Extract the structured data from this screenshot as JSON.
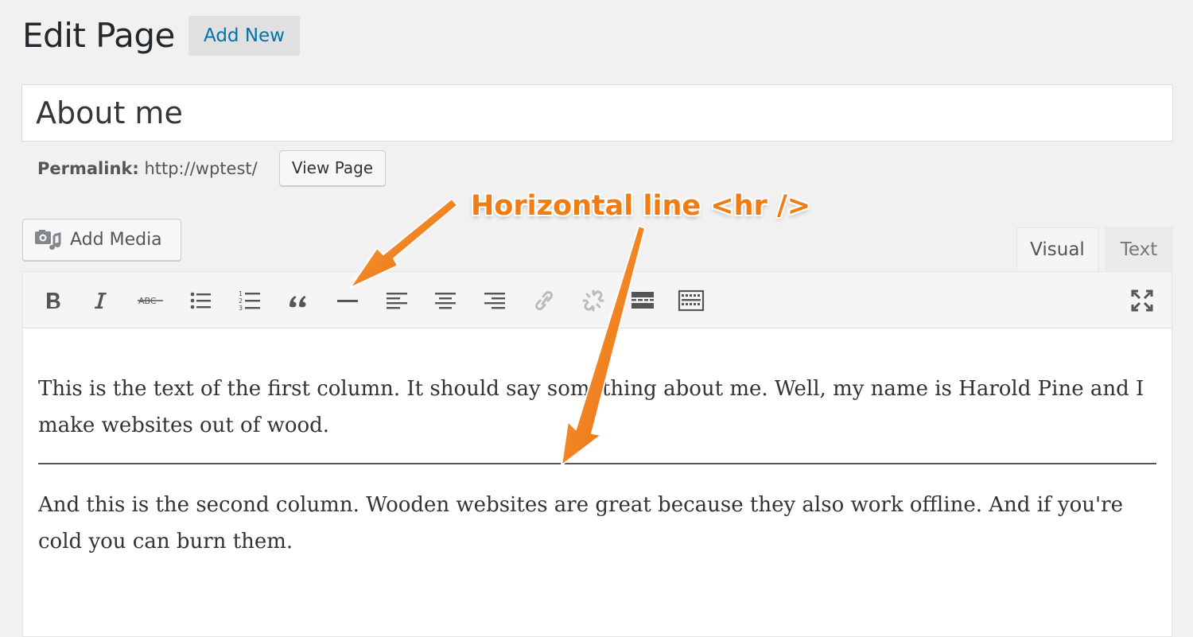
{
  "header": {
    "title": "Edit Page",
    "add_new_label": "Add New"
  },
  "post": {
    "title_value": "About me",
    "permalink_label": "Permalink:",
    "permalink_url": "http://wptest/",
    "view_page_label": "View Page"
  },
  "media": {
    "add_media_label": "Add Media"
  },
  "tabs": [
    {
      "label": "Visual",
      "active": true
    },
    {
      "label": "Text",
      "active": false
    }
  ],
  "toolbar": {
    "buttons": [
      "bold-icon",
      "italic-icon",
      "strikethrough-icon",
      "bullet-list-icon",
      "numbered-list-icon",
      "blockquote-icon",
      "horizontal-line-icon",
      "align-left-icon",
      "align-center-icon",
      "align-right-icon",
      "link-icon",
      "unlink-icon",
      "read-more-icon",
      "toolbar-toggle-icon",
      "fullscreen-icon"
    ]
  },
  "content": {
    "paragraph1": "This is the text of the first column. It should say something about me. Well, my name is Harold Pine and I make websites out of wood.",
    "paragraph2": "And this is the second column. Wooden websites are great because they also work offline. And if you're cold you can burn them."
  },
  "annotation": {
    "text": "Horizontal line <hr />",
    "color": "#f07c12"
  }
}
